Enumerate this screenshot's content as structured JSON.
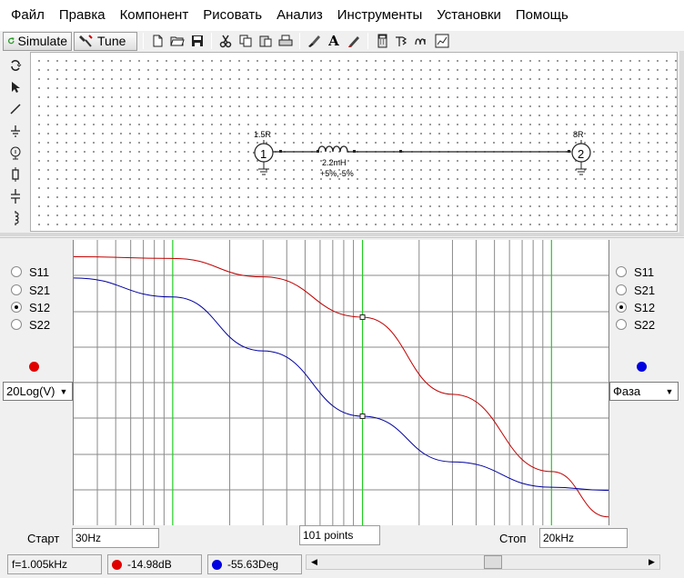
{
  "menu": [
    "Файл",
    "Правка",
    "Компонент",
    "Рисовать",
    "Анализ",
    "Инструменты",
    "Установки",
    "Помощь"
  ],
  "toolbar": {
    "simulate_label": "Simulate",
    "tune_label": "Tune"
  },
  "schematic": {
    "port1": {
      "label": "1.5R",
      "number": "1"
    },
    "port2": {
      "label": "8R",
      "number": "2"
    },
    "inductor": {
      "value": "2.2mH",
      "tolerance": "+5%,-5%"
    }
  },
  "left_panel": {
    "params": [
      "S11",
      "S21",
      "S12",
      "S22"
    ],
    "selected": "S12",
    "marker_color": "#e00000",
    "scale_value": "20Log(V)"
  },
  "right_panel": {
    "params": [
      "S11",
      "S21",
      "S12",
      "S22"
    ],
    "selected": "S12",
    "marker_color": "#0000e0",
    "scale_value": "Фаза"
  },
  "sweep": {
    "start_label": "Старт",
    "start_value": "30Hz",
    "points_value": "101 points",
    "stop_label": "Стоп",
    "stop_value": "20kHz"
  },
  "status": {
    "frequency": "f=1.005kHz",
    "magnitude": "-14.98dB",
    "phase": "-55.63Deg"
  },
  "chart_data": {
    "type": "line",
    "title": "",
    "xlabel": "",
    "ylabel": "",
    "grid": true,
    "x_scale": "log",
    "x": [
      30,
      100,
      300,
      1005,
      3000,
      10000,
      20000
    ],
    "cursors_hz": [
      100,
      1005,
      10000
    ],
    "marker_x_hz": 1005,
    "series": [
      {
        "color": "#c00000",
        "values": [
          0.0,
          -0.1,
          -1.2,
          -3.6,
          -8.2,
          -12.8,
          -15.5
        ],
        "y_min": -16,
        "y_max": 1
      },
      {
        "color": "#0000a0",
        "values": [
          -12,
          -18,
          -35,
          -55.6,
          -70,
          -78,
          -79
        ],
        "y_min": -90,
        "y_max": 0
      }
    ]
  }
}
